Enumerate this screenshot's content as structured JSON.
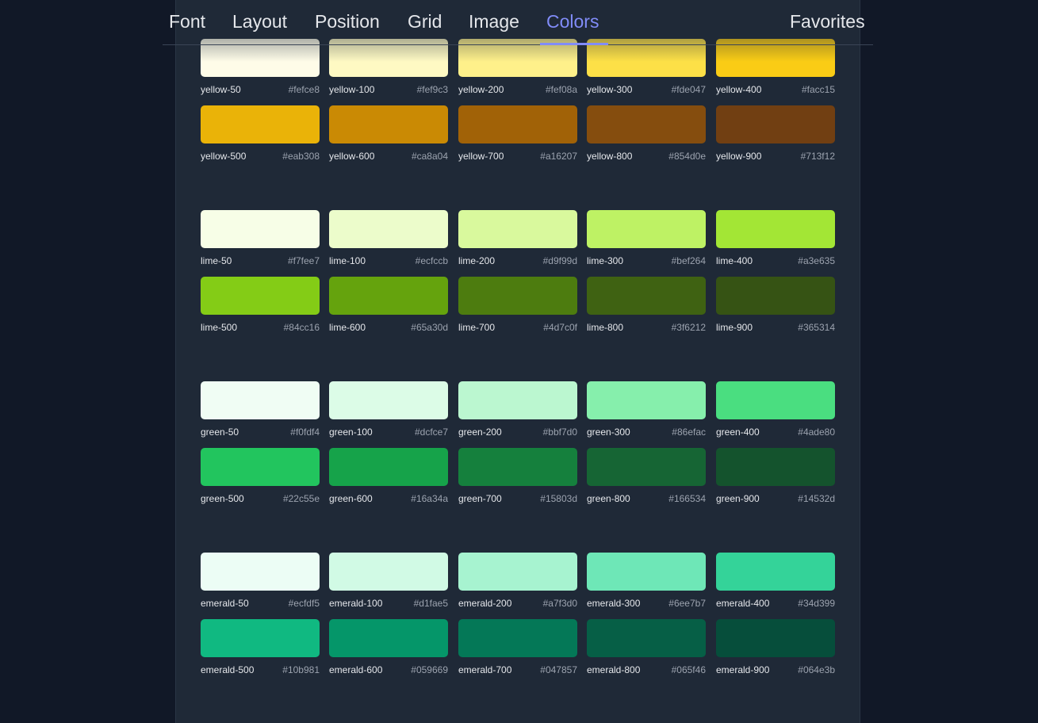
{
  "nav": {
    "tabs": [
      {
        "label": "Font"
      },
      {
        "label": "Layout"
      },
      {
        "label": "Position"
      },
      {
        "label": "Grid"
      },
      {
        "label": "Image"
      },
      {
        "label": "Colors"
      }
    ],
    "active_tab": "Colors",
    "favorites": "Favorites",
    "accent": "#818cf8"
  },
  "palettes": [
    {
      "name": "yellow",
      "rows": [
        [
          {
            "name": "yellow-50",
            "hex": "#fefce8"
          },
          {
            "name": "yellow-100",
            "hex": "#fef9c3"
          },
          {
            "name": "yellow-200",
            "hex": "#fef08a"
          },
          {
            "name": "yellow-300",
            "hex": "#fde047"
          },
          {
            "name": "yellow-400",
            "hex": "#facc15"
          }
        ],
        [
          {
            "name": "yellow-500",
            "hex": "#eab308"
          },
          {
            "name": "yellow-600",
            "hex": "#ca8a04"
          },
          {
            "name": "yellow-700",
            "hex": "#a16207"
          },
          {
            "name": "yellow-800",
            "hex": "#854d0e"
          },
          {
            "name": "yellow-900",
            "hex": "#713f12"
          }
        ]
      ]
    },
    {
      "name": "lime",
      "rows": [
        [
          {
            "name": "lime-50",
            "hex": "#f7fee7"
          },
          {
            "name": "lime-100",
            "hex": "#ecfccb"
          },
          {
            "name": "lime-200",
            "hex": "#d9f99d"
          },
          {
            "name": "lime-300",
            "hex": "#bef264"
          },
          {
            "name": "lime-400",
            "hex": "#a3e635"
          }
        ],
        [
          {
            "name": "lime-500",
            "hex": "#84cc16"
          },
          {
            "name": "lime-600",
            "hex": "#65a30d"
          },
          {
            "name": "lime-700",
            "hex": "#4d7c0f"
          },
          {
            "name": "lime-800",
            "hex": "#3f6212"
          },
          {
            "name": "lime-900",
            "hex": "#365314"
          }
        ]
      ]
    },
    {
      "name": "green",
      "rows": [
        [
          {
            "name": "green-50",
            "hex": "#f0fdf4"
          },
          {
            "name": "green-100",
            "hex": "#dcfce7"
          },
          {
            "name": "green-200",
            "hex": "#bbf7d0"
          },
          {
            "name": "green-300",
            "hex": "#86efac"
          },
          {
            "name": "green-400",
            "hex": "#4ade80"
          }
        ],
        [
          {
            "name": "green-500",
            "hex": "#22c55e"
          },
          {
            "name": "green-600",
            "hex": "#16a34a"
          },
          {
            "name": "green-700",
            "hex": "#15803d"
          },
          {
            "name": "green-800",
            "hex": "#166534"
          },
          {
            "name": "green-900",
            "hex": "#14532d"
          }
        ]
      ]
    },
    {
      "name": "emerald",
      "rows": [
        [
          {
            "name": "emerald-50",
            "hex": "#ecfdf5"
          },
          {
            "name": "emerald-100",
            "hex": "#d1fae5"
          },
          {
            "name": "emerald-200",
            "hex": "#a7f3d0"
          },
          {
            "name": "emerald-300",
            "hex": "#6ee7b7"
          },
          {
            "name": "emerald-400",
            "hex": "#34d399"
          }
        ],
        [
          {
            "name": "emerald-500",
            "hex": "#10b981"
          },
          {
            "name": "emerald-600",
            "hex": "#059669"
          },
          {
            "name": "emerald-700",
            "hex": "#047857"
          },
          {
            "name": "emerald-800",
            "hex": "#065f46"
          },
          {
            "name": "emerald-900",
            "hex": "#064e3b"
          }
        ]
      ]
    }
  ]
}
